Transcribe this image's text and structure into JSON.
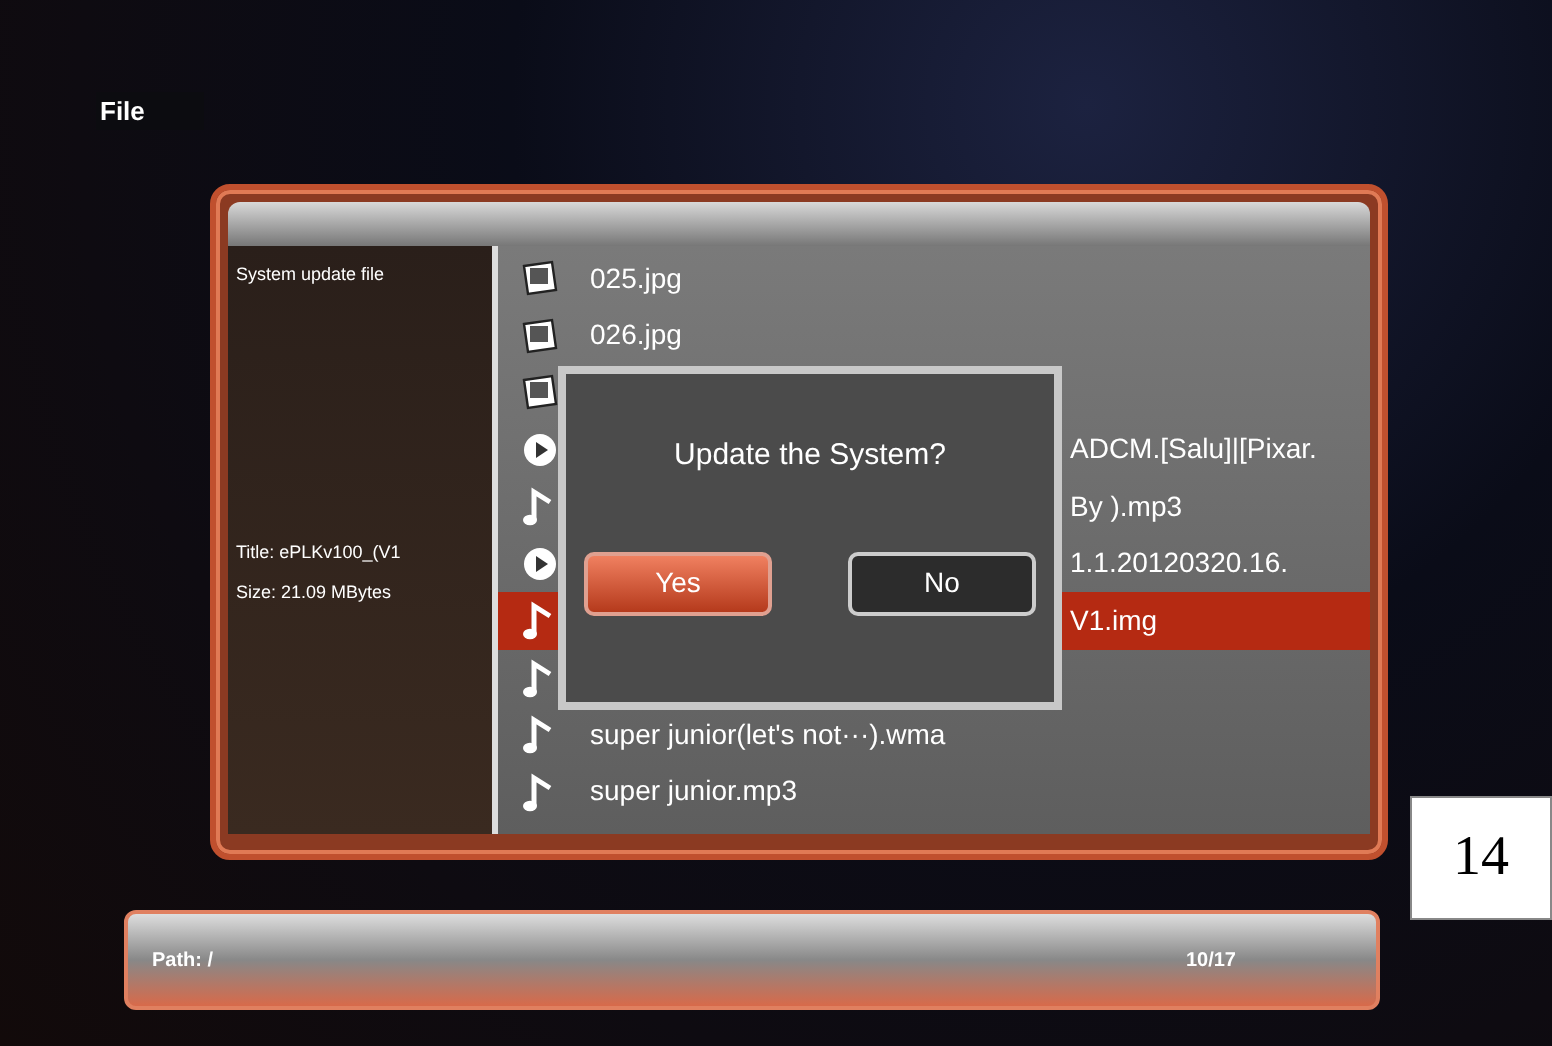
{
  "header": {
    "title": "File"
  },
  "info_panel": {
    "heading": "System update file",
    "details": [
      "Title: ePLKv100_(V1",
      "Size: 21.09 MBytes"
    ]
  },
  "files": [
    {
      "kind": "image",
      "name": "025.jpg",
      "covered": false,
      "selected": false
    },
    {
      "kind": "image",
      "name": "026.jpg",
      "covered": false,
      "selected": false
    },
    {
      "kind": "image",
      "selected": false
    },
    {
      "kind": "video",
      "name": "ADCM.[Salu]|[Pixar.",
      "covered": true,
      "selected": false
    },
    {
      "kind": "music",
      "name": "By ).mp3",
      "covered": true,
      "selected": false
    },
    {
      "kind": "video",
      "name": "1.1.20120320.16.",
      "covered": true,
      "selected": false
    },
    {
      "kind": "music",
      "name": "V1.img",
      "covered": true,
      "selected": true
    },
    {
      "kind": "music",
      "selected": false
    },
    {
      "kind": "music",
      "name": "super junior(let's not···).wma",
      "covered": false,
      "selected": false
    },
    {
      "kind": "music",
      "name": "super junior.mp3",
      "covered": false,
      "selected": false
    }
  ],
  "dialog": {
    "message": "Update the System?",
    "buttons": [
      {
        "label": "Yes",
        "selected": true
      },
      {
        "label": "No",
        "selected": false
      }
    ]
  },
  "footer": {
    "path": "Path: /",
    "count": "10/17"
  },
  "page_number": "14"
}
